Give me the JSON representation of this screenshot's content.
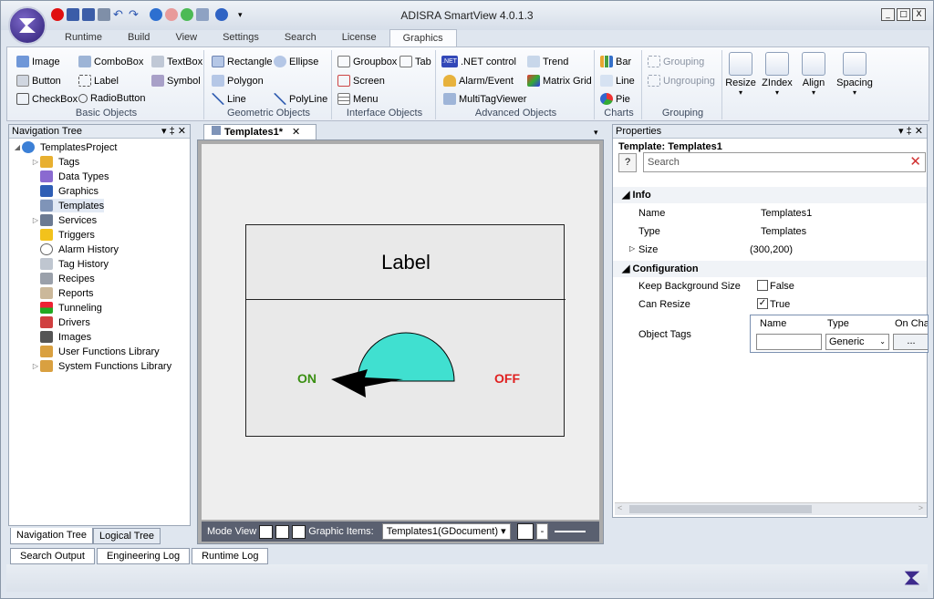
{
  "app": {
    "title": "ADISRA SmartView 4.0.1.3"
  },
  "ribbon_tabs": [
    "Runtime",
    "Build",
    "View",
    "Settings",
    "Search",
    "License",
    "Graphics"
  ],
  "groups": {
    "basic": {
      "caption": "Basic Objects",
      "items": [
        "Image",
        "ComboBox",
        "TextBox",
        "Button",
        "Label",
        "Symbol",
        "CheckBox",
        "RadioButton"
      ]
    },
    "geometric": {
      "caption": "Geometric Objects",
      "items": [
        "Rectangle",
        "Ellipse",
        "Polygon",
        "Line",
        "PolyLine"
      ]
    },
    "interface": {
      "caption": "Interface Objects",
      "items": [
        "Groupbox",
        "Tab",
        "Screen",
        "Menu"
      ]
    },
    "advanced": {
      "caption": "Advanced Objects",
      "items": [
        ".NET control",
        "Trend",
        "Alarm/Event",
        "Matrix Grid",
        "MultiTagViewer"
      ],
      "net_badge": ".NET"
    },
    "charts": {
      "caption": "Charts",
      "items": [
        "Bar",
        "Line",
        "Pie"
      ]
    },
    "grouping": {
      "caption": "Grouping",
      "items": [
        "Grouping",
        "Ungrouping"
      ]
    },
    "layout": {
      "items": [
        "Resize",
        "ZIndex",
        "Align",
        "Spacing"
      ]
    }
  },
  "nav": {
    "title": "Navigation Tree",
    "root": "TemplatesProject",
    "items": [
      "Tags",
      "Data Types",
      "Graphics",
      "Templates",
      "Services",
      "Triggers",
      "Alarm History",
      "Tag History",
      "Recipes",
      "Reports",
      "Tunneling",
      "Drivers",
      "Images",
      "User Functions Library",
      "System Functions Library"
    ],
    "tabs": [
      "Navigation Tree",
      "Logical Tree"
    ]
  },
  "doc": {
    "tab": "Templates1*",
    "label_text": "Label",
    "on": "ON",
    "off": "OFF",
    "mode_view": "Mode View",
    "graphic_items": "Graphic Items:",
    "graphic_selected": "Templates1(GDocument)",
    "minus": "-"
  },
  "props": {
    "title": "Properties",
    "subject_label": "Template:",
    "subject": "Templates1",
    "search_placeholder": "Search",
    "help": "?",
    "sections": {
      "info": "Info",
      "config": "Configuration"
    },
    "rows": {
      "name": {
        "key": "Name",
        "val": "Templates1"
      },
      "type": {
        "key": "Type",
        "val": "Templates"
      },
      "size": {
        "key": "Size",
        "val": "(300,200)"
      },
      "keep": {
        "key": "Keep Background Size",
        "val": "False"
      },
      "resize": {
        "key": "Can Resize",
        "val": "True"
      },
      "tags": {
        "key": "Object Tags"
      }
    },
    "table": {
      "cols": [
        "Name",
        "Type",
        "On Chan"
      ],
      "type_value": "Generic",
      "ellipsis": "..."
    }
  },
  "bottom_tabs": [
    "Search Output",
    "Engineering Log",
    "Runtime Log"
  ],
  "colors": {
    "accent": "#3d2a8c",
    "on": "#3a8f12",
    "off": "#e02020",
    "gauge": "#40e0d0"
  }
}
